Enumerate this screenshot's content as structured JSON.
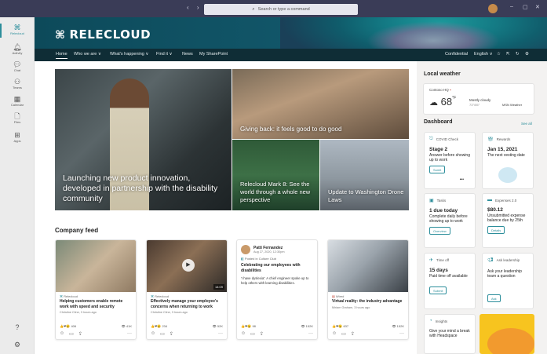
{
  "titlebar": {
    "search_placeholder": "Search or type a command",
    "nav": "‹ ›"
  },
  "rail": {
    "items": [
      {
        "label": "Relecloud",
        "icon": "app-icon"
      },
      {
        "label": "Activity",
        "icon": "bell-icon"
      },
      {
        "label": "Chat",
        "icon": "chat-icon"
      },
      {
        "label": "Teams",
        "icon": "teams-icon"
      },
      {
        "label": "Calendar",
        "icon": "calendar-icon"
      },
      {
        "label": "Files",
        "icon": "file-icon"
      },
      {
        "label": "Apps",
        "icon": "apps-icon"
      }
    ]
  },
  "site": {
    "title": "RELECLOUD"
  },
  "nav": {
    "items": [
      "Home",
      "Who we are ∨",
      "What's happening ∨",
      "Find it ∨",
      "News",
      "My SharePoint"
    ],
    "right": [
      "Confidential",
      "English ∨"
    ]
  },
  "heroes": {
    "main": "Launching new product innovation, developed in partnership with the disability community",
    "top_right": "Giving back: it feels good to do good",
    "bottom_left": "Relecloud Mark 8: See the world through a whole new perspective",
    "bottom_right": "Update to Washington Drone Laws"
  },
  "feed": {
    "title": "Company feed",
    "cards": [
      {
        "source": "Relecloud",
        "title": "Helping customers enable remote work with speed and security",
        "author": "Christine Cline, 3 hours ago",
        "reactions": "406",
        "views": "41K"
      },
      {
        "source": "Relecloud",
        "title": "Effectively manage your employee's concerns when returning to work",
        "author": "Christine Cline, 3 hours ago",
        "reactions": "234",
        "views": "52K",
        "duration": "14:09"
      },
      {
        "source": "Posted in Culture Club",
        "poster": "Patti Fernandez",
        "posted": "Aug 27, 2020, 12:30pm",
        "title": "Celebrating our employees with disabilities",
        "body": "'I have dyslexia': A chief engineer spoke up to help others with learning disabilities.",
        "reactions": "98",
        "views": "152K"
      },
      {
        "source": "Wired",
        "title": "Virtual reality: the industry advantage",
        "author": "Miriam Graham, 3 hours ago",
        "reactions": "637",
        "views": "152K"
      }
    ]
  },
  "side": {
    "weather_title": "Local weather",
    "weather": {
      "location": "Contoso HQ",
      "temp": "68",
      "unit": "°F",
      "condition": "Mostly cloudy",
      "range": "73°/55°",
      "provider": "MSN Weather"
    },
    "dashboard_title": "Dashboard",
    "see_all": "See all",
    "tiles": [
      {
        "app": "COVID Check",
        "big": "Stage 2",
        "sub": "Answer before showing up to work",
        "btn": "Sumit",
        "extra": "•••"
      },
      {
        "app": "Rewards",
        "big": "Jan 15, 2021",
        "sub": "The next vesting date"
      },
      {
        "app": "Tasks",
        "big": "1 due today",
        "sub": "Complete daily before showing up to work",
        "btn": "Overview"
      },
      {
        "app": "Expenses 2.0",
        "big": "$80.12",
        "sub": "Unsubmitted expense balance due by 25th",
        "btn": "Details"
      },
      {
        "app": "Time off",
        "big": "15 days",
        "sub": "Paid time off available",
        "btn": "Submit"
      },
      {
        "app": "Ask leadership",
        "sub": "Ask your leadership team a question",
        "btn": "Ask"
      },
      {
        "app": "Insights",
        "sub": "Give your mind a break with Headspace"
      }
    ]
  }
}
